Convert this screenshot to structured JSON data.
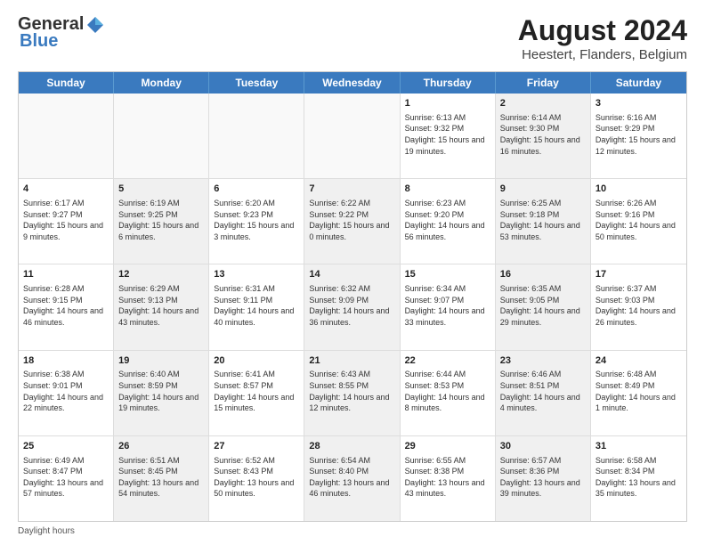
{
  "header": {
    "logo_general": "General",
    "logo_blue": "Blue",
    "main_title": "August 2024",
    "subtitle": "Heestert, Flanders, Belgium"
  },
  "days_of_week": [
    "Sunday",
    "Monday",
    "Tuesday",
    "Wednesday",
    "Thursday",
    "Friday",
    "Saturday"
  ],
  "rows": [
    [
      {
        "day": "",
        "text": "",
        "empty": true
      },
      {
        "day": "",
        "text": "",
        "empty": true
      },
      {
        "day": "",
        "text": "",
        "empty": true
      },
      {
        "day": "",
        "text": "",
        "empty": true
      },
      {
        "day": "1",
        "text": "Sunrise: 6:13 AM\nSunset: 9:32 PM\nDaylight: 15 hours and 19 minutes.",
        "empty": false,
        "shaded": false
      },
      {
        "day": "2",
        "text": "Sunrise: 6:14 AM\nSunset: 9:30 PM\nDaylight: 15 hours and 16 minutes.",
        "empty": false,
        "shaded": true
      },
      {
        "day": "3",
        "text": "Sunrise: 6:16 AM\nSunset: 9:29 PM\nDaylight: 15 hours and 12 minutes.",
        "empty": false,
        "shaded": false
      }
    ],
    [
      {
        "day": "4",
        "text": "Sunrise: 6:17 AM\nSunset: 9:27 PM\nDaylight: 15 hours and 9 minutes.",
        "empty": false,
        "shaded": false
      },
      {
        "day": "5",
        "text": "Sunrise: 6:19 AM\nSunset: 9:25 PM\nDaylight: 15 hours and 6 minutes.",
        "empty": false,
        "shaded": true
      },
      {
        "day": "6",
        "text": "Sunrise: 6:20 AM\nSunset: 9:23 PM\nDaylight: 15 hours and 3 minutes.",
        "empty": false,
        "shaded": false
      },
      {
        "day": "7",
        "text": "Sunrise: 6:22 AM\nSunset: 9:22 PM\nDaylight: 15 hours and 0 minutes.",
        "empty": false,
        "shaded": true
      },
      {
        "day": "8",
        "text": "Sunrise: 6:23 AM\nSunset: 9:20 PM\nDaylight: 14 hours and 56 minutes.",
        "empty": false,
        "shaded": false
      },
      {
        "day": "9",
        "text": "Sunrise: 6:25 AM\nSunset: 9:18 PM\nDaylight: 14 hours and 53 minutes.",
        "empty": false,
        "shaded": true
      },
      {
        "day": "10",
        "text": "Sunrise: 6:26 AM\nSunset: 9:16 PM\nDaylight: 14 hours and 50 minutes.",
        "empty": false,
        "shaded": false
      }
    ],
    [
      {
        "day": "11",
        "text": "Sunrise: 6:28 AM\nSunset: 9:15 PM\nDaylight: 14 hours and 46 minutes.",
        "empty": false,
        "shaded": false
      },
      {
        "day": "12",
        "text": "Sunrise: 6:29 AM\nSunset: 9:13 PM\nDaylight: 14 hours and 43 minutes.",
        "empty": false,
        "shaded": true
      },
      {
        "day": "13",
        "text": "Sunrise: 6:31 AM\nSunset: 9:11 PM\nDaylight: 14 hours and 40 minutes.",
        "empty": false,
        "shaded": false
      },
      {
        "day": "14",
        "text": "Sunrise: 6:32 AM\nSunset: 9:09 PM\nDaylight: 14 hours and 36 minutes.",
        "empty": false,
        "shaded": true
      },
      {
        "day": "15",
        "text": "Sunrise: 6:34 AM\nSunset: 9:07 PM\nDaylight: 14 hours and 33 minutes.",
        "empty": false,
        "shaded": false
      },
      {
        "day": "16",
        "text": "Sunrise: 6:35 AM\nSunset: 9:05 PM\nDaylight: 14 hours and 29 minutes.",
        "empty": false,
        "shaded": true
      },
      {
        "day": "17",
        "text": "Sunrise: 6:37 AM\nSunset: 9:03 PM\nDaylight: 14 hours and 26 minutes.",
        "empty": false,
        "shaded": false
      }
    ],
    [
      {
        "day": "18",
        "text": "Sunrise: 6:38 AM\nSunset: 9:01 PM\nDaylight: 14 hours and 22 minutes.",
        "empty": false,
        "shaded": false
      },
      {
        "day": "19",
        "text": "Sunrise: 6:40 AM\nSunset: 8:59 PM\nDaylight: 14 hours and 19 minutes.",
        "empty": false,
        "shaded": true
      },
      {
        "day": "20",
        "text": "Sunrise: 6:41 AM\nSunset: 8:57 PM\nDaylight: 14 hours and 15 minutes.",
        "empty": false,
        "shaded": false
      },
      {
        "day": "21",
        "text": "Sunrise: 6:43 AM\nSunset: 8:55 PM\nDaylight: 14 hours and 12 minutes.",
        "empty": false,
        "shaded": true
      },
      {
        "day": "22",
        "text": "Sunrise: 6:44 AM\nSunset: 8:53 PM\nDaylight: 14 hours and 8 minutes.",
        "empty": false,
        "shaded": false
      },
      {
        "day": "23",
        "text": "Sunrise: 6:46 AM\nSunset: 8:51 PM\nDaylight: 14 hours and 4 minutes.",
        "empty": false,
        "shaded": true
      },
      {
        "day": "24",
        "text": "Sunrise: 6:48 AM\nSunset: 8:49 PM\nDaylight: 14 hours and 1 minute.",
        "empty": false,
        "shaded": false
      }
    ],
    [
      {
        "day": "25",
        "text": "Sunrise: 6:49 AM\nSunset: 8:47 PM\nDaylight: 13 hours and 57 minutes.",
        "empty": false,
        "shaded": false
      },
      {
        "day": "26",
        "text": "Sunrise: 6:51 AM\nSunset: 8:45 PM\nDaylight: 13 hours and 54 minutes.",
        "empty": false,
        "shaded": true
      },
      {
        "day": "27",
        "text": "Sunrise: 6:52 AM\nSunset: 8:43 PM\nDaylight: 13 hours and 50 minutes.",
        "empty": false,
        "shaded": false
      },
      {
        "day": "28",
        "text": "Sunrise: 6:54 AM\nSunset: 8:40 PM\nDaylight: 13 hours and 46 minutes.",
        "empty": false,
        "shaded": true
      },
      {
        "day": "29",
        "text": "Sunrise: 6:55 AM\nSunset: 8:38 PM\nDaylight: 13 hours and 43 minutes.",
        "empty": false,
        "shaded": false
      },
      {
        "day": "30",
        "text": "Sunrise: 6:57 AM\nSunset: 8:36 PM\nDaylight: 13 hours and 39 minutes.",
        "empty": false,
        "shaded": true
      },
      {
        "day": "31",
        "text": "Sunrise: 6:58 AM\nSunset: 8:34 PM\nDaylight: 13 hours and 35 minutes.",
        "empty": false,
        "shaded": false
      }
    ]
  ],
  "footer": "Daylight hours"
}
